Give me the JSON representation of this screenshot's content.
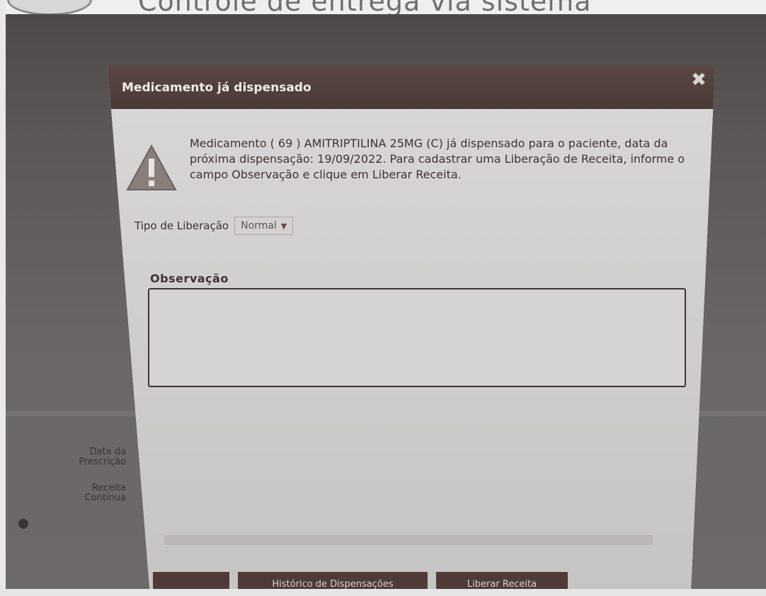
{
  "app_title": "Controle de entrega via sistema",
  "dialog": {
    "title": "Medicamento já dispensado",
    "message": "Medicamento ( 69 ) AMITRIPTILINA 25MG (C) já dispensado para o paciente, data da próxima dispensação: 19/09/2022. Para cadastrar uma Liberação de Receita, informe o campo Observação e clique em Liberar Receita.",
    "tipo_label": "Tipo de Liberação",
    "tipo_selected": "Normal",
    "obs_label": "Observação",
    "obs_value": "",
    "buttons": {
      "historico": "Histórico de Dispensações",
      "liberar": "Liberar Receita"
    }
  },
  "background_form": {
    "data_prescricao_label": "Data da Prescrição",
    "receita_continua_label": "Receita Contínua"
  },
  "colors": {
    "header_bg": "#4a3a37",
    "button_bg": "#4e3b38",
    "dialog_bg": "#cfcdcc"
  },
  "icons": [
    "warning-icon",
    "close-icon",
    "chevron-down-icon"
  ]
}
